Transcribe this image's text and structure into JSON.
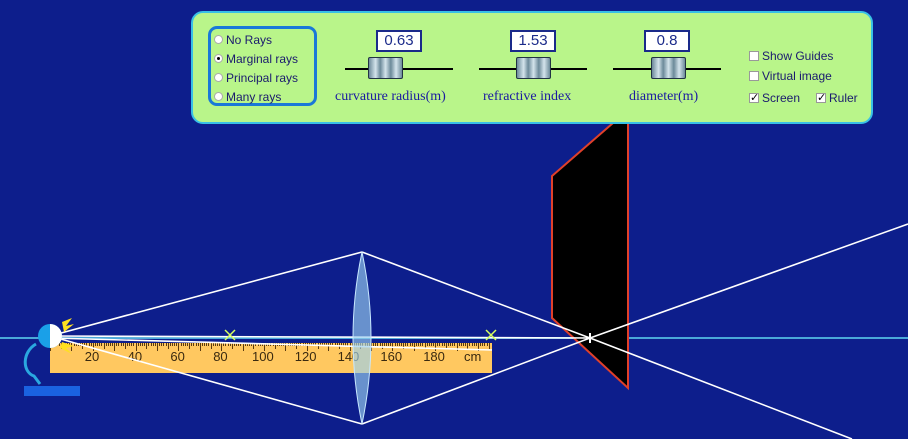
{
  "rays_mode": {
    "options": [
      "No Rays",
      "Marginal rays",
      "Principal rays",
      "Many rays"
    ],
    "selected_index": 1
  },
  "sliders": [
    {
      "label": "curvature radius(m)",
      "value": "0.63"
    },
    {
      "label": "refractive index",
      "value": "1.53"
    },
    {
      "label": "diameter(m)",
      "value": "0.8"
    }
  ],
  "checkboxes": {
    "show_guides": {
      "label": "Show Guides",
      "checked": false
    },
    "virtual_image": {
      "label": "Virtual image",
      "checked": false
    },
    "screen": {
      "label": "Screen",
      "checked": true
    },
    "ruler": {
      "label": "Ruler",
      "checked": true
    }
  },
  "ruler": {
    "labels": [
      "20",
      "40",
      "60",
      "80",
      "100",
      "120",
      "140",
      "160",
      "180"
    ],
    "unit": "cm"
  },
  "colors": {
    "background": "#0d1e8c",
    "panel": "#b9f58a",
    "panel_border": "#38c0e6",
    "ruler": "#ffc860",
    "screen_outline": "#e0402a",
    "rays": "#ffffff",
    "axis": "#4aa8d8",
    "focus_marker": "#d8ff60"
  },
  "icons": [
    "light-source-icon",
    "focal-point-marker",
    "image-point-marker"
  ]
}
